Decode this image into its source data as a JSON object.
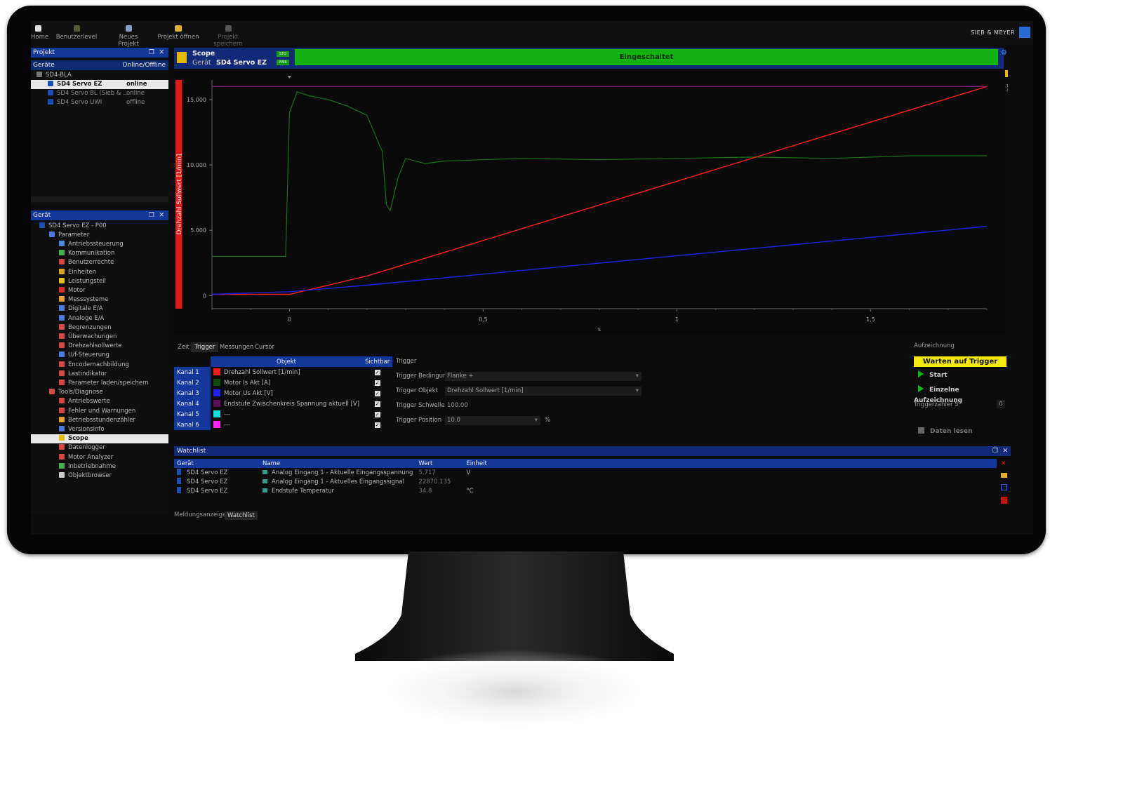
{
  "brand": {
    "name": "SIEB & MEYER"
  },
  "toolbar": {
    "home": "Home",
    "benutzerlevel": "Benutzerlevel",
    "neues_projekt": "Neues Projekt",
    "projekt_oeffnen": "Projekt öffnen",
    "projekt_speichern": "Projekt speichern"
  },
  "projekt_panel": {
    "title": "Projekt",
    "col_geraete": "Geräte",
    "col_online": "Online/Offline",
    "root": "SD4-BLA",
    "devices": [
      {
        "name": "SD4 Servo EZ",
        "status": "online"
      },
      {
        "name": "SD4 Servo BL (Sieb & ...",
        "status": "online"
      },
      {
        "name": "SD4 Servo UWI",
        "status": "offline"
      }
    ]
  },
  "geraet_panel": {
    "title": "Gerät",
    "root": "SD4 Servo EZ - P00",
    "parameter": "Parameter",
    "parameter_items": [
      "Antriebssteuerung",
      "Kommunikation",
      "Benutzerrechte",
      "Einheiten",
      "Leistungsteil",
      "Motor",
      "Messsysteme",
      "Digitale E/A",
      "Analoge E/A",
      "Begrenzungen",
      "Überwachungen",
      "Drehzahlsollwerte",
      "U/f-Steuerung",
      "Encodernachbildung",
      "Lastindikator",
      "Parameter laden/speichern"
    ],
    "tools": "Tools/Diagnose",
    "tools_items": [
      "Antriebswerte",
      "Fehler und Warnungen",
      "Betriebsstundenzähler",
      "Versionsinfo",
      "Scope",
      "Datenlogger",
      "Motor Analyzer",
      "Inbetriebnahme",
      "Objektbrowser"
    ]
  },
  "scope": {
    "title": "Scope",
    "geraet_label": "Gerät",
    "geraet_value": "SD4 Servo EZ",
    "tag_sto": "STO",
    "tag_pwr": "PWR",
    "state": "Eingeschaltet"
  },
  "chart_data": {
    "type": "line",
    "ylabel": "Drehzahl Sollwert [1/min]",
    "xlabel": "s",
    "xlim": [
      -0.2,
      1.8
    ],
    "ylim": [
      -1000,
      16500
    ],
    "x_ticks": [
      "0",
      "0,5",
      "1",
      "1,5"
    ],
    "x_tick_values": [
      0,
      0.5,
      1,
      1.5
    ],
    "y_ticks": [
      "0",
      "5.000",
      "10.000",
      "15.000"
    ],
    "y_tick_values": [
      0,
      5000,
      10000,
      15000
    ],
    "grid": false,
    "series": [
      {
        "name": "Drehzahl Sollwert [1/min]",
        "color": "#ff1e1e",
        "x": [
          -0.2,
          0,
          0.2,
          1.8
        ],
        "y": [
          100,
          100,
          1500,
          16000
        ]
      },
      {
        "name": "Motor Is Akt [A]",
        "color": "#1b6e1b",
        "x": [
          -0.2,
          -0.01,
          0,
          0.02,
          0.05,
          0.1,
          0.15,
          0.2,
          0.24,
          0.25,
          0.26,
          0.28,
          0.3,
          0.35,
          0.4,
          0.6,
          0.8,
          1.0,
          1.2,
          1.4,
          1.6,
          1.8
        ],
        "y": [
          3000,
          3000,
          14000,
          15600,
          15300,
          15000,
          14500,
          13800,
          11000,
          7000,
          6500,
          9000,
          10500,
          10100,
          10300,
          10500,
          10400,
          10500,
          10600,
          10500,
          10700,
          10700
        ]
      },
      {
        "name": "Motor Us Akt [V]",
        "color": "#1f22e0",
        "x": [
          -0.2,
          0,
          0.2,
          1.8
        ],
        "y": [
          100,
          300,
          800,
          5300
        ]
      },
      {
        "name": "Endstufe Zwischenkreis Spannung aktuell [V]",
        "color": "#7a1a7a",
        "x": [
          -0.2,
          1.8
        ],
        "y": [
          16000,
          16000
        ]
      }
    ]
  },
  "tabs": [
    "Zeit",
    "Trigger",
    "Messungen",
    "Cursor"
  ],
  "channels": {
    "col_objekt": "Objekt",
    "col_sichtbar": "Sichtbar",
    "rows": [
      {
        "kanal": "Kanal 1",
        "color": "#ff1a1a",
        "objekt": "Drehzahl Sollwert [1/min]",
        "check": "✓"
      },
      {
        "kanal": "Kanal 2",
        "color": "#0f4a0f",
        "objekt": "Motor Is Akt [A]",
        "check": "✓"
      },
      {
        "kanal": "Kanal 3",
        "color": "#1f22ff",
        "objekt": "Motor Us Akt [V]",
        "check": "✓"
      },
      {
        "kanal": "Kanal 4",
        "color": "#5a0f5a",
        "objekt": "Endstufe Zwischenkreis Spannung aktuell [V]",
        "check": "✓"
      },
      {
        "kanal": "Kanal 5",
        "color": "#10e0e0",
        "objekt": "---",
        "check": "✓"
      },
      {
        "kanal": "Kanal 6",
        "color": "#ff20ff",
        "objekt": "---",
        "check": "✓"
      }
    ]
  },
  "trigger": {
    "section": "Trigger",
    "bedingung_label": "Trigger Bedingung",
    "bedingung_value": "Flanke +",
    "objekt_label": "Trigger Objekt",
    "objekt_value": "Drehzahl Sollwert [1/min]",
    "schwelle_label": "Trigger Schwelle",
    "schwelle_value": "100.00",
    "position_label": "Trigger Position",
    "position_value": "10.0",
    "position_unit": "%"
  },
  "aufzeichnung": {
    "title": "Aufzeichnung",
    "warten": "Warten auf Trigger",
    "start": "Start",
    "einzelne": "Einzelne Aufzeichnung",
    "triggerzaehler_label": "Triggerzähler",
    "triggerzaehler_value": "5",
    "counter_box": "0",
    "daten_lesen": "Daten lesen"
  },
  "watchlist": {
    "title": "Watchlist",
    "cols": [
      "Gerät",
      "Name",
      "Wert",
      "Einheit"
    ],
    "rows": [
      {
        "geraet": "SD4 Servo EZ",
        "name": "Analog Eingang 1 - Aktuelle Eingangsspannung",
        "wert": "5.717",
        "einheit": "V"
      },
      {
        "geraet": "SD4 Servo EZ",
        "name": "Analog Eingang 1 - Aktuelles Eingangssignal",
        "wert": "22870.135",
        "einheit": ""
      },
      {
        "geraet": "SD4 Servo EZ",
        "name": "Endstufe Temperatur",
        "wert": "34.8",
        "einheit": "°C"
      }
    ]
  },
  "bottom_tabs": [
    "Meldungsanzeige",
    "Watchlist"
  ]
}
